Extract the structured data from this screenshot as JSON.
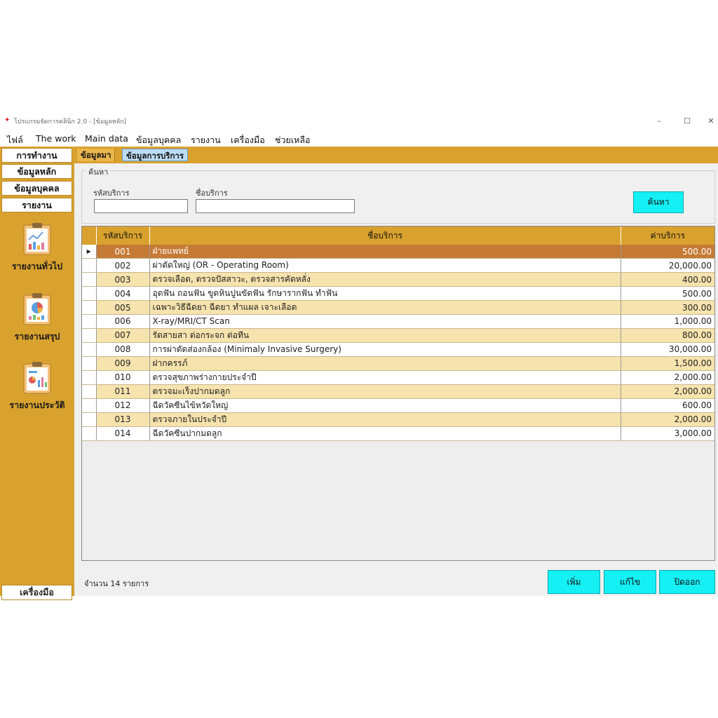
{
  "window": {
    "title": "โปรแกรมจัดการคลินิก 2.0 - [ข้อมูลหลัก]",
    "controls": {
      "minimize": "–",
      "maximize": "☐",
      "close": "✕"
    }
  },
  "menu": [
    "ไฟล์",
    "The work",
    "Main data",
    "ข้อมูลบุคคล",
    "รายงาน",
    "เครื่องมือ",
    "ช่วยเหลือ"
  ],
  "sidebar": {
    "nav": [
      "การทำงาน",
      "ข้อมูลหลัก",
      "ข้อมูลบุคคล",
      "รายงาน"
    ],
    "reports": [
      "รายงานทั่วไป",
      "รายงานสรุป",
      "รายงานประวัติ"
    ],
    "tools": "เครื่องมือ"
  },
  "tabs": {
    "main": "ข้อมูลมา",
    "service": "ข้อมูลการบริการ"
  },
  "search": {
    "group_label": "ค้นหา",
    "code_label": "รหัสบริการ",
    "code_value": "",
    "name_label": "ชื่อบริการ",
    "name_value": "",
    "button": "ค้นหา"
  },
  "table": {
    "headers": {
      "code": "รหัสบริการ",
      "name": "ชื่อบริการ",
      "price": "ค่าบริการ"
    },
    "selected_index": 0,
    "rows": [
      {
        "code": "001",
        "name": "ฝ่ายแพทย์",
        "price": "500.00"
      },
      {
        "code": "002",
        "name": "ผ่าตัดใหญ่ (OR - Operating Room)",
        "price": "20,000.00"
      },
      {
        "code": "003",
        "name": "ตรวจเลือด, ตรวจปัสสาวะ, ตรวจสารคัดหลั่ง",
        "price": "400.00"
      },
      {
        "code": "004",
        "name": "อุดฟัน ถอนฟัน ขูดหินปูนขัดฟัน รักษารากฟัน ทำฟัน",
        "price": "500.00"
      },
      {
        "code": "005",
        "name": "เฉพาะวิธีฉีดยา ฉีดยา ทำแผล เจาะเลือด",
        "price": "300.00"
      },
      {
        "code": "006",
        "name": "X-ray/MRI/CT Scan",
        "price": "1,000.00"
      },
      {
        "code": "007",
        "name": " รัดสายสา ต่อกระจก ต่อทีน",
        "price": "800.00"
      },
      {
        "code": "008",
        "name": "การผ่าตัดส่องกล้อง (Minimaly Invasive Surgery)",
        "price": "30,000.00"
      },
      {
        "code": "009",
        "name": "ฝากครรภ์",
        "price": "1,500.00"
      },
      {
        "code": "010",
        "name": "ตรวจสุขภาพร่างกายประจำปี",
        "price": "2,000.00"
      },
      {
        "code": "011",
        "name": "ตรวจมะเร็งปากมดลูก",
        "price": "2,000.00"
      },
      {
        "code": "012",
        "name": "ฉีดวัคซีนไข้หวัดใหญ่",
        "price": "600.00"
      },
      {
        "code": "013",
        "name": "ตรวจภายในประจำปี",
        "price": "2,000.00"
      },
      {
        "code": "014",
        "name": "ฉีดวัคซีนปากมดลูก",
        "price": "3,000.00"
      }
    ]
  },
  "status": {
    "count_text": "จำนวน 14 รายการ"
  },
  "buttons": {
    "add": "เพิ่ม",
    "edit": "แก้ไข",
    "close": "ปิดออก"
  },
  "colors": {
    "accent": "#d9a22e",
    "button": "#14f0f4",
    "row_odd": "#f6e3ad",
    "row_selected": "#c57a35"
  },
  "icons": {
    "report1": "clipboard-chart-icon",
    "report2": "clipboard-pie-icon",
    "report3": "clipboard-bar-icon"
  }
}
